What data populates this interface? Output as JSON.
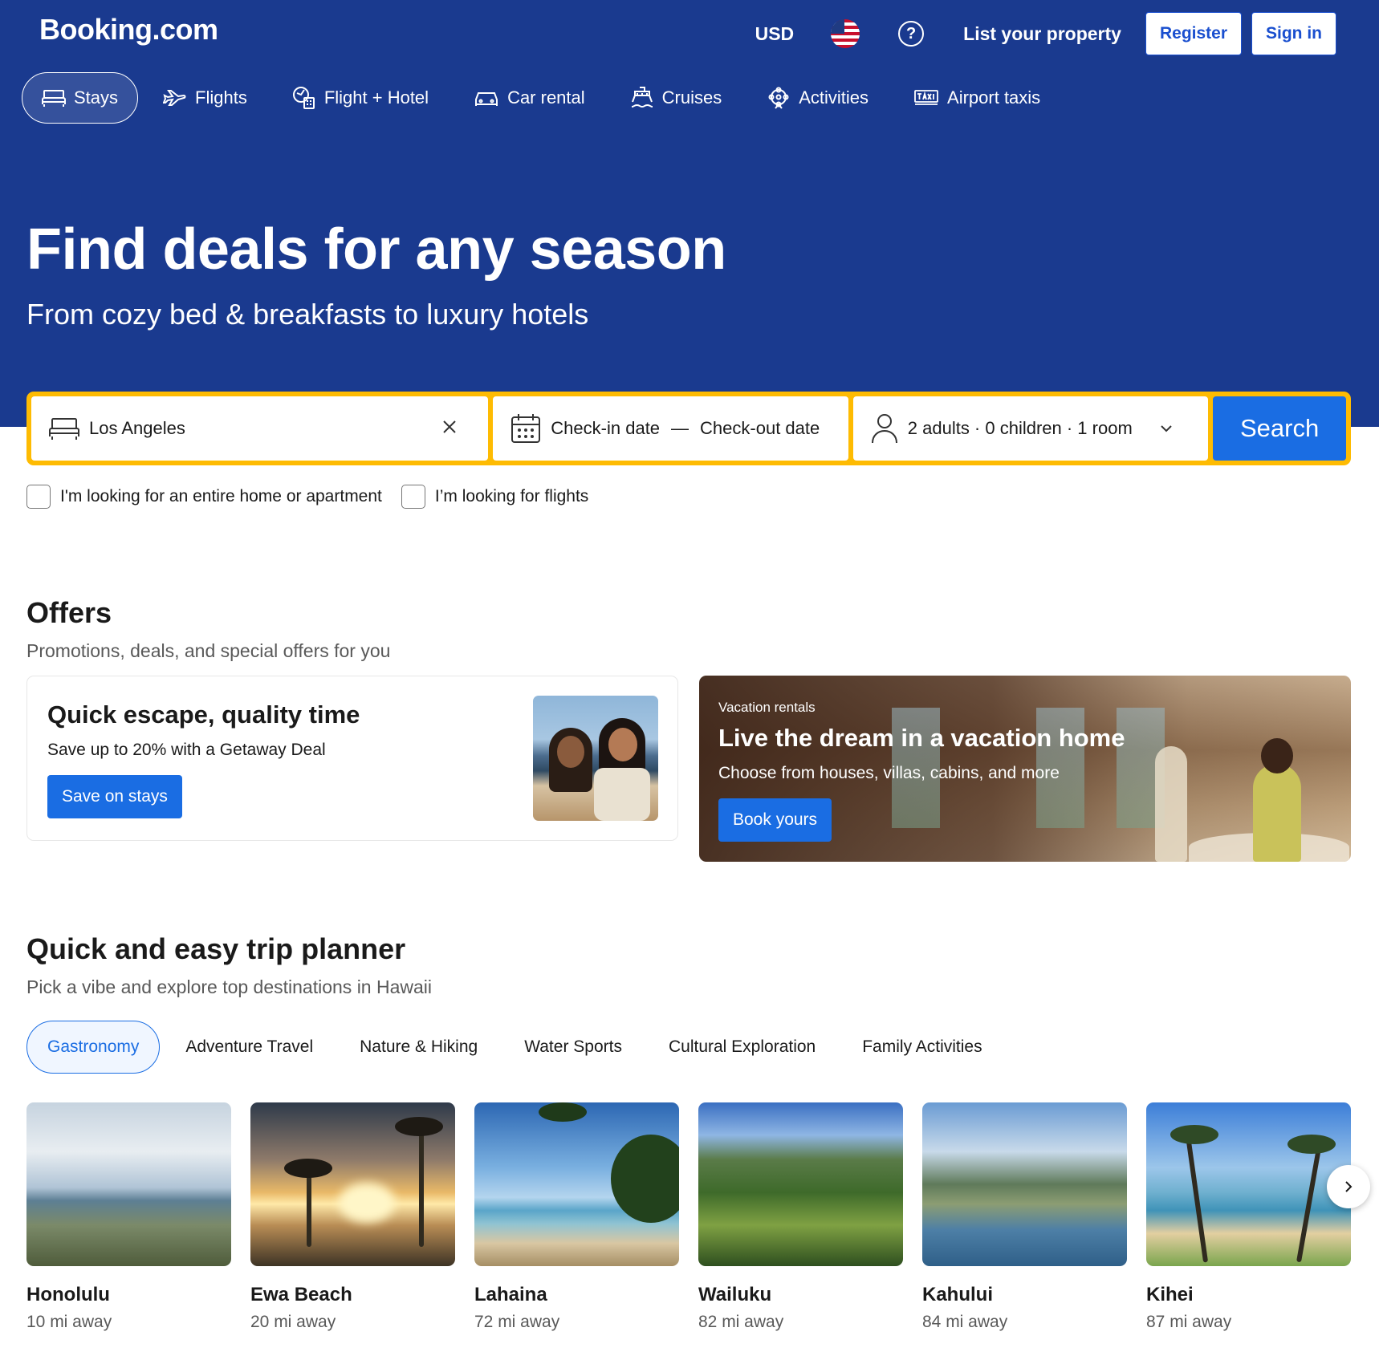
{
  "header": {
    "logo": "Booking.com",
    "currency": "USD",
    "language_icon": "us-flag-icon",
    "help_icon": "help-icon",
    "list_property": "List your property",
    "register": "Register",
    "sign_in": "Sign in"
  },
  "nav": {
    "items": [
      {
        "label": "Stays",
        "icon": "bed-icon",
        "active": true
      },
      {
        "label": "Flights",
        "icon": "plane-icon"
      },
      {
        "label": "Flight + Hotel",
        "icon": "flight-hotel-icon"
      },
      {
        "label": "Car rental",
        "icon": "car-icon"
      },
      {
        "label": "Cruises",
        "icon": "cruise-icon"
      },
      {
        "label": "Activities",
        "icon": "activities-icon"
      },
      {
        "label": "Airport taxis",
        "icon": "taxi-icon"
      }
    ]
  },
  "hero": {
    "title": "Find deals for any season",
    "subtitle": "From cozy bed & breakfasts to luxury hotels"
  },
  "search": {
    "destination": "Los Angeles",
    "checkin": "Check-in date",
    "separator": "—",
    "checkout": "Check-out date",
    "guests": "2 adults · 0 children · 1 room",
    "button": "Search",
    "options": [
      {
        "label": "I'm looking for an entire home or apartment",
        "checked": false
      },
      {
        "label": "I’m looking for flights",
        "checked": false
      }
    ]
  },
  "offers": {
    "title": "Offers",
    "subtitle": "Promotions, deals, and special offers for you",
    "card1": {
      "title": "Quick escape, quality time",
      "text": "Save up to 20% with a Getaway Deal",
      "button": "Save on stays"
    },
    "card2": {
      "tag": "Vacation rentals",
      "title": "Live the dream in a vacation home",
      "text": "Choose from houses, villas, cabins, and more",
      "button": "Book yours"
    }
  },
  "planner": {
    "title": "Quick and easy trip planner",
    "subtitle": "Pick a vibe and explore top destinations in Hawaii",
    "tabs": [
      {
        "label": "Gastronomy",
        "active": true
      },
      {
        "label": "Adventure Travel"
      },
      {
        "label": "Nature & Hiking"
      },
      {
        "label": "Water Sports"
      },
      {
        "label": "Cultural Exploration"
      },
      {
        "label": "Family Activities"
      }
    ],
    "destinations": [
      {
        "name": "Honolulu",
        "distance": "10 mi away"
      },
      {
        "name": "Ewa Beach",
        "distance": "20 mi away"
      },
      {
        "name": "Lahaina",
        "distance": "72 mi away"
      },
      {
        "name": "Wailuku",
        "distance": "82 mi away"
      },
      {
        "name": "Kahului",
        "distance": "84 mi away"
      },
      {
        "name": "Kihei",
        "distance": "87 mi away"
      }
    ],
    "next_icon": "chevron-right-icon"
  },
  "colors": {
    "brand_blue": "#1a3a8f",
    "action_blue": "#1a6de3",
    "search_border": "#febb02"
  }
}
